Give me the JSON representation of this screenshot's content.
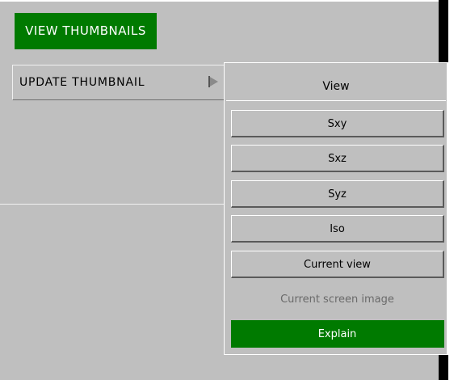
{
  "buttons": {
    "view_thumbnails": "VIEW THUMBNAILS",
    "update_thumbnail": "UPDATE THUMBNAIL"
  },
  "view_menu": {
    "title": "View",
    "items": [
      {
        "label": "Sxy",
        "enabled": true
      },
      {
        "label": "Sxz",
        "enabled": true
      },
      {
        "label": "Syz",
        "enabled": true
      },
      {
        "label": "Iso",
        "enabled": true
      },
      {
        "label": "Current view",
        "enabled": true
      },
      {
        "label": "Current screen image",
        "enabled": false
      },
      {
        "label": "Explain",
        "enabled": true
      }
    ]
  },
  "colors": {
    "accent_green": "#007a00",
    "panel_grey": "#bfbfbf"
  },
  "icons": {
    "submenu_arrow": "play-arrow-icon"
  }
}
